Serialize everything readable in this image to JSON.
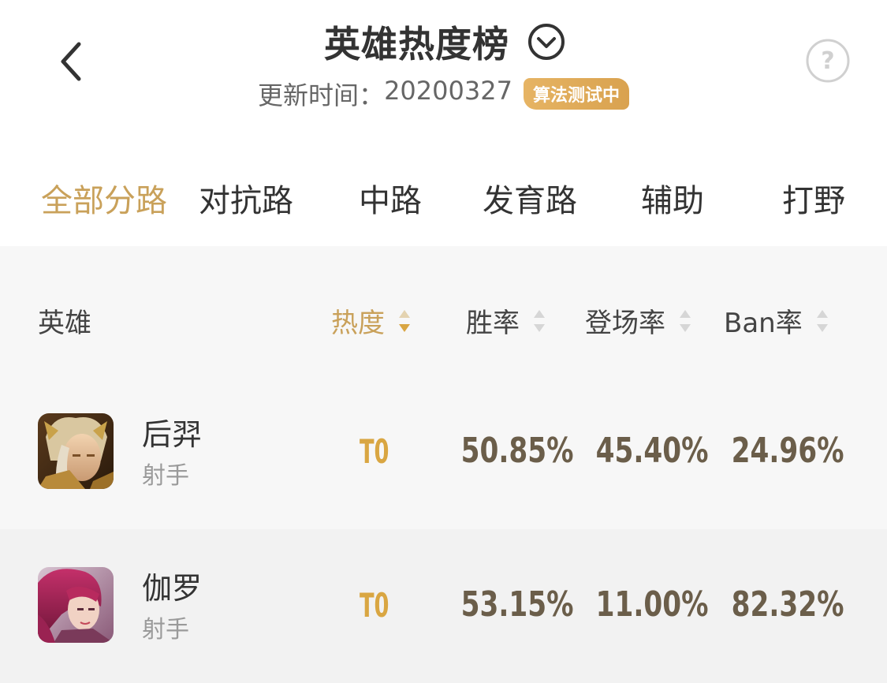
{
  "header": {
    "title": "英雄热度榜",
    "update_label": "更新时间：",
    "update_value": "20200327",
    "badge": "算法测试中"
  },
  "tabs": [
    {
      "label": "全部分路",
      "active": true
    },
    {
      "label": "对抗路",
      "active": false
    },
    {
      "label": "中路",
      "active": false
    },
    {
      "label": "发育路",
      "active": false
    },
    {
      "label": "辅助",
      "active": false
    },
    {
      "label": "打野",
      "active": false
    }
  ],
  "columns": {
    "hero": "英雄",
    "heat": "热度",
    "win_rate": "胜率",
    "pick_rate": "登场率",
    "ban_rate": "Ban率"
  },
  "sort": {
    "active_column": "heat",
    "direction": "desc"
  },
  "heroes": [
    {
      "name": "后羿",
      "role": "射手",
      "tier": "T0",
      "win_rate": "50.85%",
      "pick_rate": "45.40%",
      "ban_rate": "24.96%",
      "avatar_icon": "hero-avatar-houyi"
    },
    {
      "name": "伽罗",
      "role": "射手",
      "tier": "T0",
      "win_rate": "53.15%",
      "pick_rate": "11.00%",
      "ban_rate": "82.32%",
      "avatar_icon": "hero-avatar-jialuo"
    }
  ],
  "colors": {
    "accent": "#c9a15a",
    "tier": "#d9a642",
    "stat": "#6b5e4a",
    "badge": "#e0aa5a"
  }
}
